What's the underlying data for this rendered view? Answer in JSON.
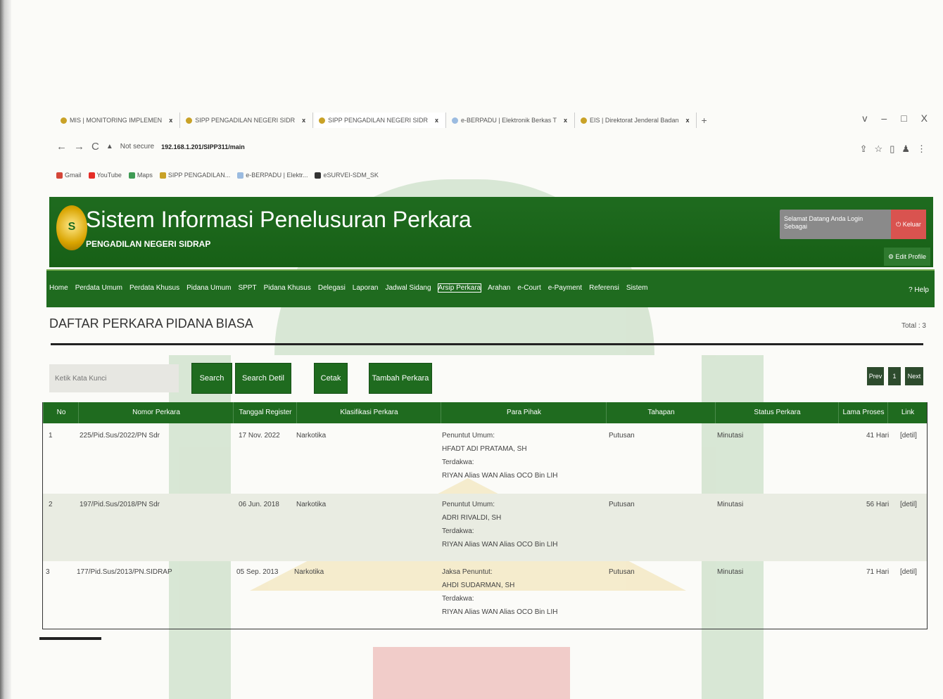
{
  "browser": {
    "tabs": [
      {
        "label": "MIS | MONITORING IMPLEMEN"
      },
      {
        "label": "SIPP PENGADILAN NEGERI SIDR"
      },
      {
        "label": "SIPP PENGADILAN NEGERI SIDR"
      },
      {
        "label": "e-BERPADU | Elektronik Berkas T"
      },
      {
        "label": "EIS | Direktorat Jenderal Badan"
      }
    ],
    "new_tab": "+",
    "window_controls": [
      "v",
      "–",
      "□",
      "X"
    ],
    "address": {
      "security": "Not secure",
      "url": "192.168.1.201/SIPP311/main"
    },
    "bookmarks": [
      "Gmail",
      "YouTube",
      "Maps",
      "SIPP PENGADILAN...",
      "e-BERPADU | Elektr...",
      "eSURVEI-SDM_SK"
    ]
  },
  "header": {
    "logo_letter": "S",
    "title": "Sistem Informasi Penelusuran Perkara",
    "subtitle": "PENGADILAN NEGERI SIDRAP",
    "welcome": "Selamat Datang Anda Login Sebagai",
    "logout": "Keluar",
    "edit_profile": "Edit Profile"
  },
  "menu": {
    "items": [
      "Home",
      "Perdata Umum",
      "Perdata Khusus",
      "Pidana Umum",
      "SPPT",
      "Pidana Khusus",
      "Delegasi",
      "Laporan",
      "Jadwal Sidang",
      "Arsip Perkara",
      "Arahan",
      "e-Court",
      "e-Payment",
      "Referensi",
      "Sistem"
    ],
    "active": "Arsip Perkara",
    "help": "Help"
  },
  "page": {
    "title": "DAFTAR PERKARA PIDANA BIASA",
    "total": "Total : 3"
  },
  "toolbar": {
    "search_placeholder": "Ketik Kata Kunci",
    "search": "Search",
    "search_detil": "Search Detil",
    "cetak": "Cetak",
    "tambah": "Tambah Perkara",
    "prev": "Prev",
    "page": "1",
    "next": "Next"
  },
  "table": {
    "columns": [
      "No",
      "Nomor Perkara",
      "Tanggal Register",
      "Klasifikasi Perkara",
      "Para Pihak",
      "Tahapan",
      "Status Perkara",
      "Lama Proses",
      "Link"
    ],
    "rows": [
      {
        "no": "1",
        "nomor": "225/Pid.Sus/2022/PN Sdr",
        "tanggal": "17 Nov. 2022",
        "klasifikasi": "Narkotika",
        "pihak_1_label": "Penuntut Umum:",
        "pihak_1_name": "HFADT ADI PRATAMA, SH",
        "pihak_2_label": "Terdakwa:",
        "pihak_2_name": "RIYAN Alias WAN Alias OCO Bin LIH",
        "tahapan": "Putusan",
        "status": "Minutasi",
        "lama": "41 Hari",
        "link": "[detil]"
      },
      {
        "no": "2",
        "nomor": "197/Pid.Sus/2018/PN Sdr",
        "tanggal": "06 Jun. 2018",
        "klasifikasi": "Narkotika",
        "pihak_1_label": "Penuntut Umum:",
        "pihak_1_name": "ADRI RIVALDI, SH",
        "pihak_2_label": "Terdakwa:",
        "pihak_2_name": "RIYAN Alias WAN Alias OCO Bin LIH",
        "tahapan": "Putusan",
        "status": "Minutasi",
        "lama": "56 Hari",
        "link": "[detil]"
      },
      {
        "no": "3",
        "nomor": "177/Pid.Sus/2013/PN.SIDRAP",
        "tanggal": "05 Sep. 2013",
        "klasifikasi": "Narkotika",
        "pihak_1_label": "Jaksa Penuntut:",
        "pihak_1_name": "AHDI SUDARMAN, SH",
        "pihak_2_label": "Terdakwa:",
        "pihak_2_name": "RIYAN Alias WAN Alias OCO Bin LIH",
        "tahapan": "Putusan",
        "status": "Minutasi",
        "lama": "71 Hari",
        "link": "[detil]"
      }
    ]
  }
}
